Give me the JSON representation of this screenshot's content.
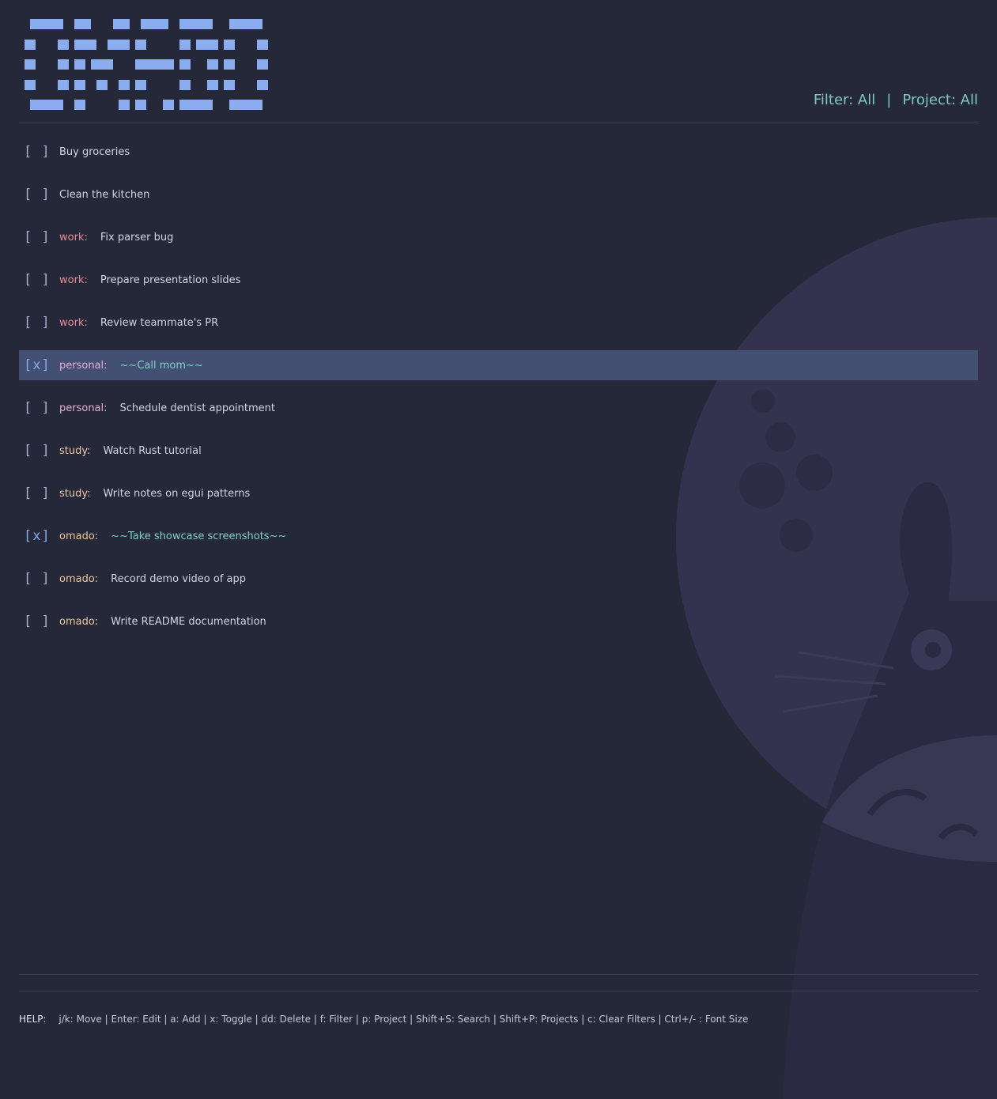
{
  "app": {
    "logo_text": "OMADO"
  },
  "header": {
    "filter_label": "Filter: All",
    "separator": "|",
    "project_label": "Project: All"
  },
  "todos": [
    {
      "checkbox": "[ ]",
      "done": false,
      "project": "",
      "title": "Buy groceries"
    },
    {
      "checkbox": "[ ]",
      "done": false,
      "project": "",
      "title": "Clean the kitchen"
    },
    {
      "checkbox": "[ ]",
      "done": false,
      "project": "work:",
      "title": "Fix parser bug"
    },
    {
      "checkbox": "[ ]",
      "done": false,
      "project": "work:",
      "title": "Prepare presentation slides"
    },
    {
      "checkbox": "[ ]",
      "done": false,
      "project": "work:",
      "title": "Review teammate's PR"
    },
    {
      "checkbox": "[x]",
      "done": true,
      "selected": true,
      "project": "personal:",
      "title": "~~Call mom~~"
    },
    {
      "checkbox": "[ ]",
      "done": false,
      "project": "personal:",
      "title": "Schedule dentist appointment"
    },
    {
      "checkbox": "[ ]",
      "done": false,
      "project": "study:",
      "title": "Watch Rust tutorial"
    },
    {
      "checkbox": "[ ]",
      "done": false,
      "project": "study:",
      "title": "Write notes on egui patterns"
    },
    {
      "checkbox": "[x]",
      "done": true,
      "project": "omado:",
      "title": "~~Take showcase screenshots~~"
    },
    {
      "checkbox": "[ ]",
      "done": false,
      "project": "omado:",
      "title": "Record demo video of app"
    },
    {
      "checkbox": "[ ]",
      "done": false,
      "project": "omado:",
      "title": "Write README documentation"
    }
  ],
  "help": {
    "label": "HELP:",
    "text": "j/k: Move | Enter: Edit | a: Add | x: Toggle | dd: Delete | f: Filter | p: Project | Shift+S: Search | Shift+P: Projects | c: Clear Filters | Ctrl+/- : Font Size"
  },
  "colors": {
    "background": "#252839",
    "selected_row": "#435074",
    "logo": "#8cacf0",
    "filter": "#7ec8c0",
    "work": "#e98a96",
    "personal": "#e6b0d6",
    "study": "#ecc6a8",
    "omado": "#ecc69a",
    "done_title": "#82cfc4"
  }
}
